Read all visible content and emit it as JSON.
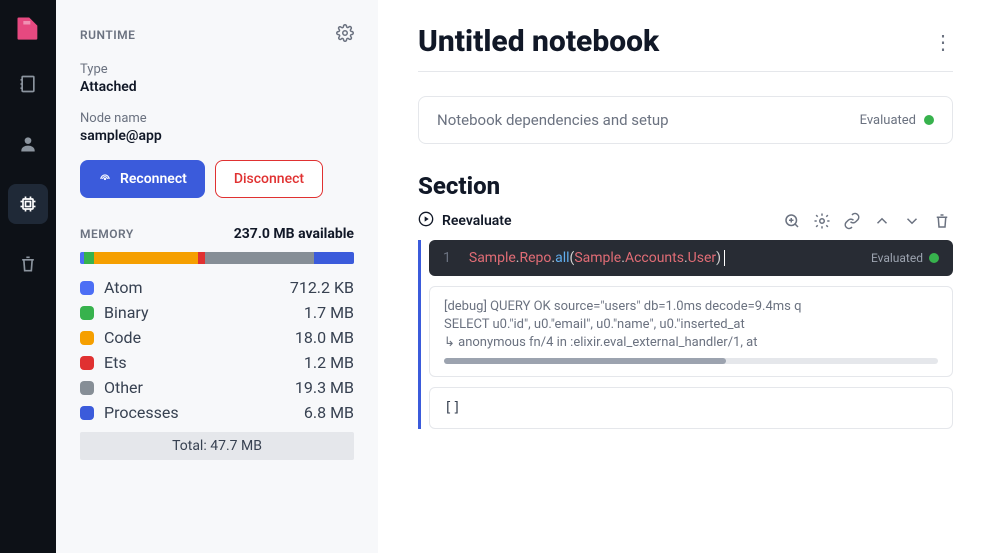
{
  "sidebar": {
    "runtime_label": "RUNTIME",
    "type_label": "Type",
    "type_value": "Attached",
    "node_label": "Node name",
    "node_value": "sample@app",
    "reconnect": "Reconnect",
    "disconnect": "Disconnect",
    "memory_label": "MEMORY",
    "memory_available": "237.0 MB available",
    "memory_items": [
      {
        "name": "Atom",
        "value": "712.2 KB",
        "color": "#4c6ef5"
      },
      {
        "name": "Binary",
        "value": "1.7 MB",
        "color": "#37b24d"
      },
      {
        "name": "Code",
        "value": "18.0 MB",
        "color": "#f59f00"
      },
      {
        "name": "Ets",
        "value": "1.2 MB",
        "color": "#e03131"
      },
      {
        "name": "Other",
        "value": "19.3 MB",
        "color": "#868e96"
      },
      {
        "name": "Processes",
        "value": "6.8 MB",
        "color": "#3b5bdb"
      }
    ],
    "memory_total": "Total: 47.7 MB"
  },
  "main": {
    "title": "Untitled notebook",
    "deps_label": "Notebook dependencies and setup",
    "deps_status": "Evaluated",
    "deps_dot": "#37b24d",
    "section_title": "Section",
    "reevaluate": "Reevaluate",
    "code": {
      "line": "1",
      "tokens": [
        {
          "t": "Sample",
          "c": "tk-red"
        },
        {
          "t": ".",
          "c": "tk-white"
        },
        {
          "t": "Repo",
          "c": "tk-red"
        },
        {
          "t": ".",
          "c": "tk-white"
        },
        {
          "t": "all",
          "c": "tk-cyan"
        },
        {
          "t": "(",
          "c": "tk-white"
        },
        {
          "t": "Sample",
          "c": "tk-red"
        },
        {
          "t": ".",
          "c": "tk-white"
        },
        {
          "t": "Accounts",
          "c": "tk-red"
        },
        {
          "t": ".",
          "c": "tk-white"
        },
        {
          "t": "User",
          "c": "tk-red"
        },
        {
          "t": ")",
          "c": "tk-white"
        }
      ],
      "status": "Evaluated",
      "dot": "#37b24d"
    },
    "output": [
      "[debug] QUERY OK source=\"users\" db=1.0ms decode=9.4ms q",
      "SELECT u0.\"id\", u0.\"email\", u0.\"name\", u0.\"inserted_at",
      "↳ anonymous fn/4 in :elixir.eval_external_handler/1, at"
    ],
    "result": "[]"
  }
}
